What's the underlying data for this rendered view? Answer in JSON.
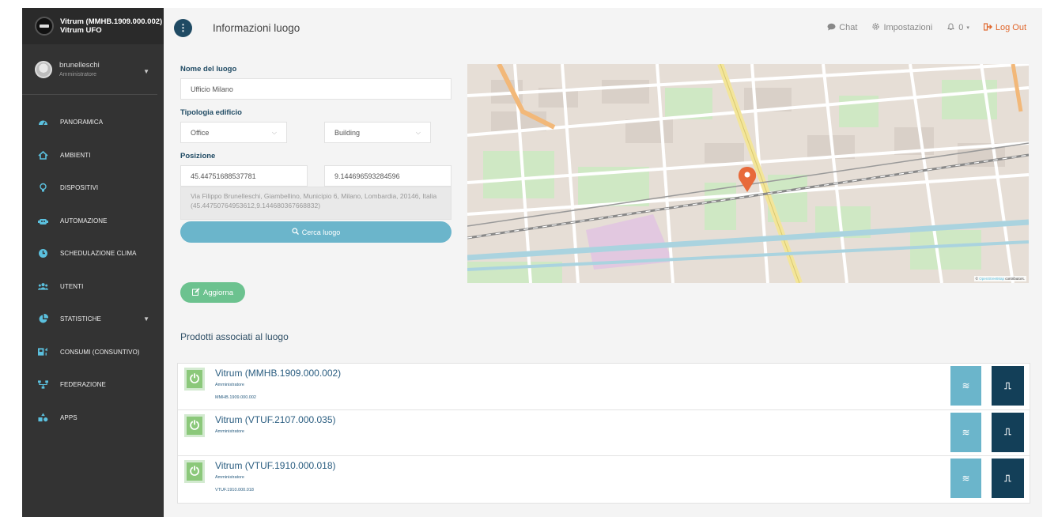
{
  "sidebar": {
    "brand_line1": "Vitrum (MMHB.1909.000.002)",
    "brand_line2": "Vitrum UFO",
    "user_name": "brunelleschi",
    "user_role": "Amministratore",
    "items": [
      {
        "label": "PANORAMICA",
        "icon": "dashboard-icon"
      },
      {
        "label": "AMBIENTI",
        "icon": "home-icon"
      },
      {
        "label": "DISPOSITIVI",
        "icon": "bulb-icon"
      },
      {
        "label": "AUTOMAZIONE",
        "icon": "robot-icon"
      },
      {
        "label": "SCHEDULAZIONE CLIMA",
        "icon": "clock-icon"
      },
      {
        "label": "UTENTI",
        "icon": "users-icon"
      },
      {
        "label": "STATISTICHE",
        "icon": "pie-chart-icon"
      },
      {
        "label": "CONSUMI (CONSUNTIVO)",
        "icon": "consumption-icon"
      },
      {
        "label": "FEDERAZIONE",
        "icon": "sitemap-icon"
      },
      {
        "label": "APPS",
        "icon": "apps-icon"
      }
    ]
  },
  "header": {
    "title": "Informazioni luogo",
    "chat": "Chat",
    "settings": "Impostazioni",
    "notifications": "0",
    "logout": "Log Out"
  },
  "form": {
    "name_label": "Nome del luogo",
    "name_value": "Ufficio Milano",
    "type_label": "Tipologia edificio",
    "type_value": "Office",
    "subtype_value": "Building",
    "position_label": "Posizione",
    "lat": "45.44751688537781",
    "lng": "9.144696593284596",
    "address": "Via Filippo Brunelleschi, Giambellino, Municipio 6, Milano, Lombardia, 20146, Italia (45.44750764953612,9.144680367668832)",
    "search_button": "Cerca luogo",
    "update_button": "Aggiorna"
  },
  "map": {
    "attribution_prefix": "©",
    "attribution_link": "OpenStreetMap",
    "attribution_suffix": "contributors."
  },
  "products": {
    "title": "Prodotti associati al luogo",
    "items": [
      {
        "name": "Vitrum (MMHB.1909.000.002)",
        "role": "Amministratore",
        "code": "MMHB.1909.000.002"
      },
      {
        "name": "Vitrum (VTUF.2107.000.035)",
        "role": "Amministratore",
        "code": ""
      },
      {
        "name": "Vitrum (VTUF.1910.000.018)",
        "role": "Amministratore",
        "code": "VTUF.1910.000.018"
      }
    ]
  },
  "colors": {
    "sidebar": "#333333",
    "accent": "#6bb5cb",
    "dark_accent": "#133f58",
    "success": "#6cc28f",
    "logout": "#e0662b"
  }
}
